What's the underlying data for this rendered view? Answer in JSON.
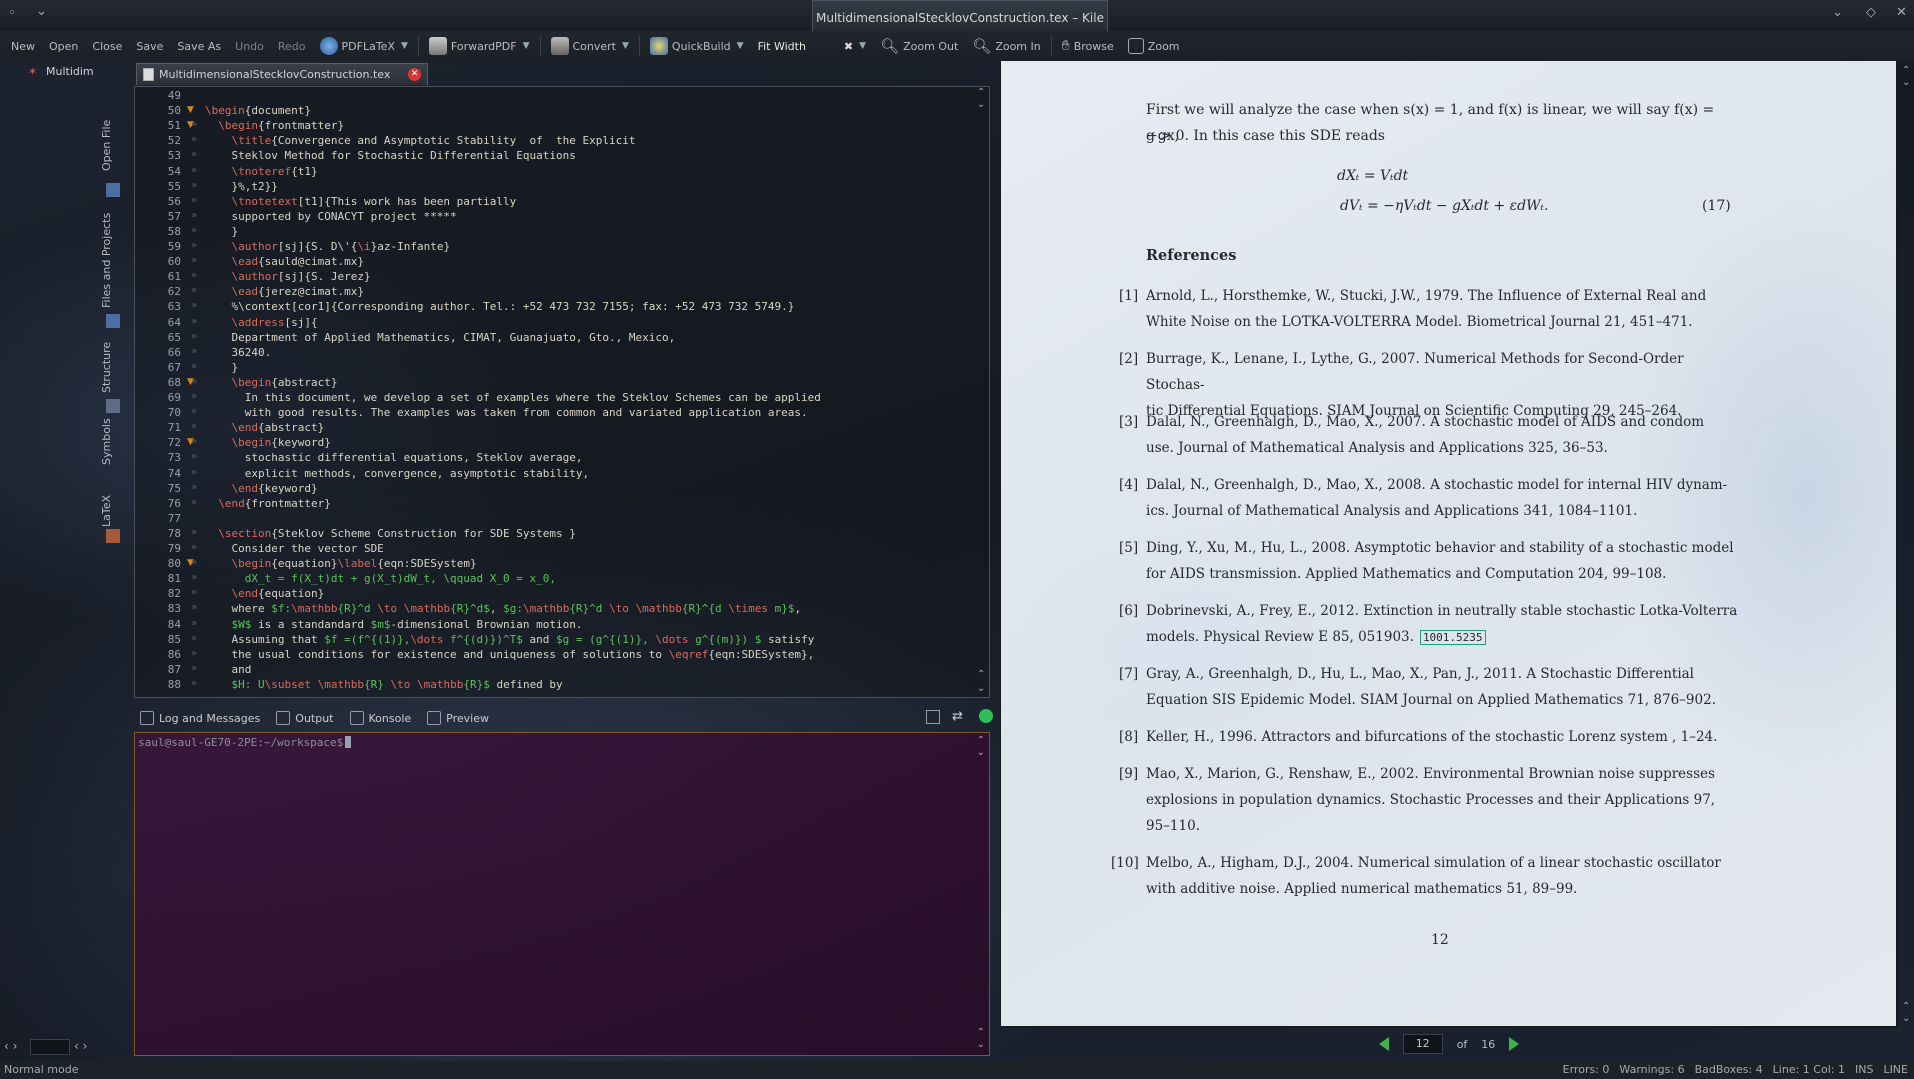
{
  "window": {
    "title": "MultidimensionalStecklovConstruction.tex – Kile"
  },
  "toolbar": {
    "new": "New",
    "open": "Open",
    "close": "Close",
    "save": "Save",
    "save_as": "Save As",
    "undo": "Undo",
    "redo": "Redo",
    "pdflatex": "PDFLaTeX",
    "forwardpdf": "ForwardPDF",
    "convert": "Convert",
    "quickbuild": "QuickBuild",
    "fit_width": "Fit Width",
    "zoom_out": "Zoom Out",
    "zoom_in": "Zoom In",
    "browse": "Browse",
    "zoom": "Zoom"
  },
  "sidebar": {
    "project_item": "Multidim",
    "vtabs": [
      "Open File",
      "Files and Projects",
      "Structure",
      "Symbols",
      "LaTeX"
    ]
  },
  "editor": {
    "tab_label": "MultidimensionalStecklovConstruction.tex",
    "lines": [
      {
        "n": "49",
        "t": ""
      },
      {
        "n": "50",
        "t": "\\begin{document}",
        "fold": true
      },
      {
        "n": "51",
        "t": "  \\begin{frontmatter}",
        "fold": true
      },
      {
        "n": "52",
        "t": "    \\title{Convergence and Asymptotic Stability  of  the Explicit"
      },
      {
        "n": "53",
        "t": "    Steklov Method for Stochastic Differential Equations"
      },
      {
        "n": "54",
        "t": "    \\tnoteref{t1}"
      },
      {
        "n": "55",
        "t": "    }%,t2}}"
      },
      {
        "n": "56",
        "t": "    \\tnotetext[t1]{This work has been partially"
      },
      {
        "n": "57",
        "t": "    supported by CONACYT project *****"
      },
      {
        "n": "58",
        "t": "    }"
      },
      {
        "n": "59",
        "t": "    \\author[sj]{S. D\\'{\\i}az-Infante}"
      },
      {
        "n": "60",
        "t": "    \\ead{sauld@cimat.mx}"
      },
      {
        "n": "61",
        "t": "    \\author[sj]{S. Jerez}"
      },
      {
        "n": "62",
        "t": "    \\ead{jerez@cimat.mx}"
      },
      {
        "n": "63",
        "t": "    %\\context[cor1]{Corresponding author. Tel.: +52 473 732 7155; fax: +52 473 732 5749.}"
      },
      {
        "n": "64",
        "t": "    \\address[sj]{"
      },
      {
        "n": "65",
        "t": "    Department of Applied Mathematics, CIMAT, Guanajuato, Gto., Mexico,"
      },
      {
        "n": "66",
        "t": "    36240."
      },
      {
        "n": "67",
        "t": "    }"
      },
      {
        "n": "68",
        "t": "    \\begin{abstract}",
        "fold": true
      },
      {
        "n": "69",
        "t": "      In this document, we develop a set of examples where the Steklov Schemes can be applied"
      },
      {
        "n": "70",
        "t": "      with good results. The examples was taken from common and variated application areas."
      },
      {
        "n": "71",
        "t": "    \\end{abstract}"
      },
      {
        "n": "72",
        "t": "    \\begin{keyword}",
        "fold": true
      },
      {
        "n": "73",
        "t": "      stochastic differential equations, Steklov average,"
      },
      {
        "n": "74",
        "t": "      explicit methods, convergence, asymptotic stability,"
      },
      {
        "n": "75",
        "t": "    \\end{keyword}"
      },
      {
        "n": "76",
        "t": "  \\end{frontmatter}"
      },
      {
        "n": "77",
        "t": ""
      },
      {
        "n": "78",
        "t": "  \\section{Steklov Scheme Construction for SDE Systems }"
      },
      {
        "n": "79",
        "t": "    Consider the vector SDE"
      },
      {
        "n": "80",
        "t": "    \\begin{equation}\\label{eqn:SDESystem}",
        "fold": true
      },
      {
        "n": "81",
        "t": "      dX_t = f(X_t)dt + g(X_t)dW_t, \\qquad X_0 = x_0,"
      },
      {
        "n": "82",
        "t": "    \\end{equation}"
      },
      {
        "n": "83",
        "t": "    where $f:\\mathbb{R}^d \\to \\mathbb{R}^d$, $g:\\mathbb{R}^d \\to \\mathbb{R}^{d \\times m}$,"
      },
      {
        "n": "84",
        "t": "    $W$ is a standandard $m$-dimensional Brownian motion."
      },
      {
        "n": "85",
        "t": "    Assuming that $f =(f^{(1)},\\dots f^{(d)})^T$ and $g = (g^{(1)}, \\dots g^{(m)}) $ satisfy"
      },
      {
        "n": "86",
        "t": "    the usual conditions for existence and uniqueness of solutions to \\eqref{eqn:SDESystem},"
      },
      {
        "n": "87",
        "t": "    and"
      },
      {
        "n": "88",
        "t": "    $H: U\\subset \\mathbb{R} \\to \\mathbb{R}$ defined by"
      }
    ]
  },
  "panel": {
    "tabs": [
      "Log and Messages",
      "Output",
      "Konsole",
      "Preview"
    ],
    "prompt": "saul@saul-GE70-2PE:~/workspace$"
  },
  "viewer": {
    "intro_line1": "First we will analyze the case when s(x) = 1, and f(x) is linear, we will say f(x) = −gx,",
    "intro_line2": "g > 0. In this case this SDE reads",
    "eq1": "dXₜ = Vₜdt",
    "eq2": "dVₜ = −ηVₜdt − gXₜdt + εdWₜ.",
    "eq_num": "(17)",
    "references_heading": "References",
    "references": [
      {
        "num": "[1]",
        "l1": "Arnold, L., Horsthemke, W., Stucki, J.W., 1979.  The Influence of External Real and",
        "l2": "White Noise on the LOTKA-VOLTERRA Model. Biometrical Journal 21, 451–471."
      },
      {
        "num": "[2]",
        "l1": "Burrage, K., Lenane, I., Lythe, G., 2007. Numerical Methods for Second-Order Stochas-",
        "l2": "tic Differential Equations. SIAM Journal on Scientific Computing 29, 245–264."
      },
      {
        "num": "[3]",
        "l1": "Dalal, N., Greenhalgh, D., Mao, X., 2007.  A stochastic model of AIDS and condom",
        "l2": "use. Journal of Mathematical Analysis and Applications 325, 36–53."
      },
      {
        "num": "[4]",
        "l1": "Dalal, N., Greenhalgh, D., Mao, X., 2008. A stochastic model for internal HIV dynam-",
        "l2": "ics. Journal of Mathematical Analysis and Applications 341, 1084–1101."
      },
      {
        "num": "[5]",
        "l1": "Ding, Y., Xu, M., Hu, L., 2008. Asymptotic behavior and stability of a stochastic model",
        "l2": "for AIDS transmission. Applied Mathematics and Computation 204, 99–108."
      },
      {
        "num": "[6]",
        "l1": "Dobrinevski, A., Frey, E., 2012. Extinction in neutrally stable stochastic Lotka-Volterra",
        "l2": "models. Physical Review E 85, 051903.",
        "arxiv": "1001.5235"
      },
      {
        "num": "[7]",
        "l1": "Gray, A., Greenhalgh, D., Hu, L., Mao, X., Pan, J., 2011.  A Stochastic Differential",
        "l2": "Equation SIS Epidemic Model. SIAM Journal on Applied Mathematics 71, 876–902."
      },
      {
        "num": "[8]",
        "l1": "Keller, H., 1996. Attractors and bifurcations of the stochastic Lorenz system , 1–24."
      },
      {
        "num": "[9]",
        "l1": "Mao, X., Marion, G., Renshaw, E., 2002.  Environmental Brownian noise suppresses",
        "l2": "explosions in population dynamics.  Stochastic Processes and their Applications 97,",
        "l3": "95–110."
      },
      {
        "num": "[10]",
        "l1": "Melbo, A., Higham, D.J., 2004.  Numerical simulation of a linear stochastic oscillator",
        "l2": "with additive noise. Applied numerical mathematics 51, 89–99."
      }
    ],
    "page_number": "12",
    "nav_current": "12",
    "nav_of": "of",
    "nav_total": "16"
  },
  "statusbar": {
    "mode": "Normal mode",
    "errors": "Errors: 0",
    "warnings": "Warnings: 6",
    "badboxes": "BadBoxes: 4",
    "position": "Line: 1 Col: 1",
    "ins": "INS",
    "line": "LINE"
  },
  "colors": {
    "fold_marker": "#d7871b",
    "latex_command": "#d96a5d",
    "latex_math": "#59c25b",
    "nav_arrow": "#3fb24a",
    "konsole_bg": "#3a1239"
  }
}
